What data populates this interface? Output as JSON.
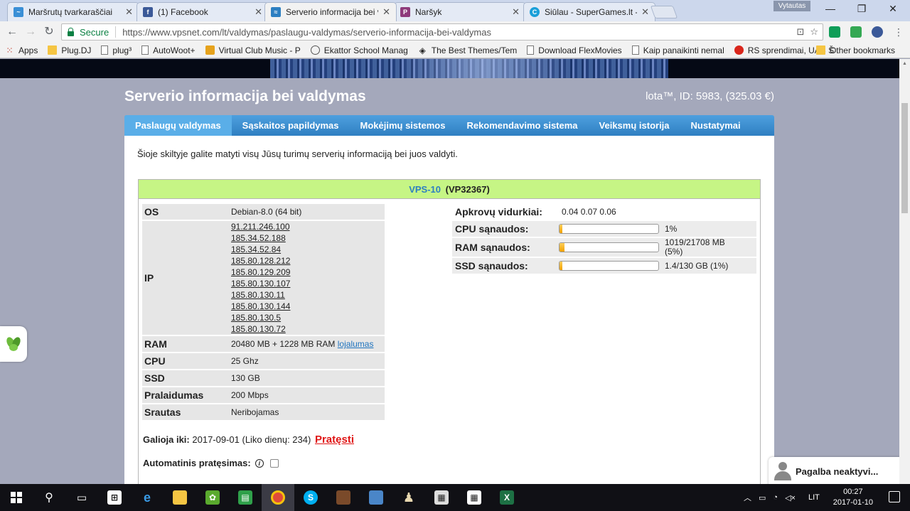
{
  "browser": {
    "tabs": [
      {
        "title": "Maršrutų tvarkaraščiai",
        "icon": "bus-schedule-icon",
        "color": "#3a8fd6",
        "active": false
      },
      {
        "title": "(1) Facebook",
        "icon": "facebook-icon",
        "color": "#3b5998",
        "active": false
      },
      {
        "title": "Serverio informacija bei v",
        "icon": "vpsnet-icon",
        "color": "#2d7fc1",
        "active": true
      },
      {
        "title": "Naršyk",
        "icon": "narsyk-icon",
        "color": "#8e3a7b",
        "active": false
      },
      {
        "title": "Siūlau - SuperGames.lt -",
        "icon": "supergames-icon",
        "color": "#1a9fd9",
        "active": false
      }
    ],
    "profile_name": "Vytautas",
    "secure_label": "Secure",
    "url": "https://www.vpsnet.com/lt/valdymas/paslaugu-valdymas/serverio-informacija-bei-valdymas",
    "bookmarks": [
      {
        "label": "Apps",
        "icon": "apps-grid-icon"
      },
      {
        "label": "Plug.DJ",
        "icon": "folder-icon"
      },
      {
        "label": "plug³",
        "icon": "page-icon"
      },
      {
        "label": "AutoWoot+",
        "icon": "page-icon"
      },
      {
        "label": "Virtual Club Music - P",
        "icon": "virtual-club-icon"
      },
      {
        "label": "Ekattor School Manag",
        "icon": "ekattor-icon"
      },
      {
        "label": "The Best Themes/Tem",
        "icon": "themes-icon"
      },
      {
        "label": "Download FlexMovies",
        "icon": "page-icon"
      },
      {
        "label": "Kaip panaikinti nemal",
        "icon": "page-icon"
      },
      {
        "label": "RS sprendimai, UAB Š",
        "icon": "rs-icon"
      }
    ],
    "other_bookmarks": "Other bookmarks"
  },
  "page": {
    "title": "Serverio informacija bei valdymas",
    "account": "lota™, ID: 5983, (325.03 €)",
    "menu": [
      {
        "label": "Paslaugų valdymas",
        "active": true
      },
      {
        "label": "Sąskaitos papildymas",
        "active": false
      },
      {
        "label": "Mokėjimų sistemos",
        "active": false
      },
      {
        "label": "Rekomendavimo sistema",
        "active": false
      },
      {
        "label": "Veiksmų istorija",
        "active": false
      },
      {
        "label": "Nustatymai",
        "active": false
      }
    ],
    "intro": "Šioje skiltyje galite matyti visų Jūsų turimų serverių informaciją bei juos valdyti.",
    "vps": {
      "name": "VPS-10",
      "code": "(VP32367)",
      "specs": {
        "os_label": "OS",
        "os_value": "Debian-8.0 (64 bit)",
        "ip_label": "IP",
        "ips": [
          "91.211.246.100",
          "185.34.52.188",
          "185.34.52.84",
          "185.80.128.212",
          "185.80.129.209",
          "185.80.130.107",
          "185.80.130.11",
          "185.80.130.144",
          "185.80.130.5",
          "185.80.130.72"
        ],
        "ram_label": "RAM",
        "ram_value": "20480 MB + 1228 MB RAM",
        "ram_link": "lojalumas",
        "cpu_label": "CPU",
        "cpu_value": "25 Ghz",
        "ssd_label": "SSD",
        "ssd_value": "130 GB",
        "bandwidth_label": "Pralaidumas",
        "bandwidth_value": "200 Mbps",
        "traffic_label": "Srautas",
        "traffic_value": "Neribojamas"
      },
      "load": {
        "avg_label": "Apkrovų vidurkiai:",
        "avg_value": "0.04 0.07 0.06",
        "cpu_label": "CPU sąnaudos:",
        "cpu_value": "1%",
        "cpu_fraction": 0.01,
        "ram_label": "RAM sąnaudos:",
        "ram_value_line1": "1019/21708 MB",
        "ram_value_line2": "(5%)",
        "ram_fraction": 0.05,
        "ssd_label": "SSD sąnaudos:",
        "ssd_value": "1.4/130 GB (1%)",
        "ssd_fraction": 0.01
      },
      "valid_label": "Galioja iki:",
      "valid_value": "2017-09-01 (Liko dienų: 234)",
      "renew_link": "Pratęsti",
      "auto_renew_label": "Automatinis pratęsimas:",
      "auto_renew_checked": false
    },
    "help_widget": "Pagalba neaktyvi..."
  },
  "taskbar": {
    "language": "LIT",
    "time": "00:27",
    "date": "2017-01-10"
  }
}
